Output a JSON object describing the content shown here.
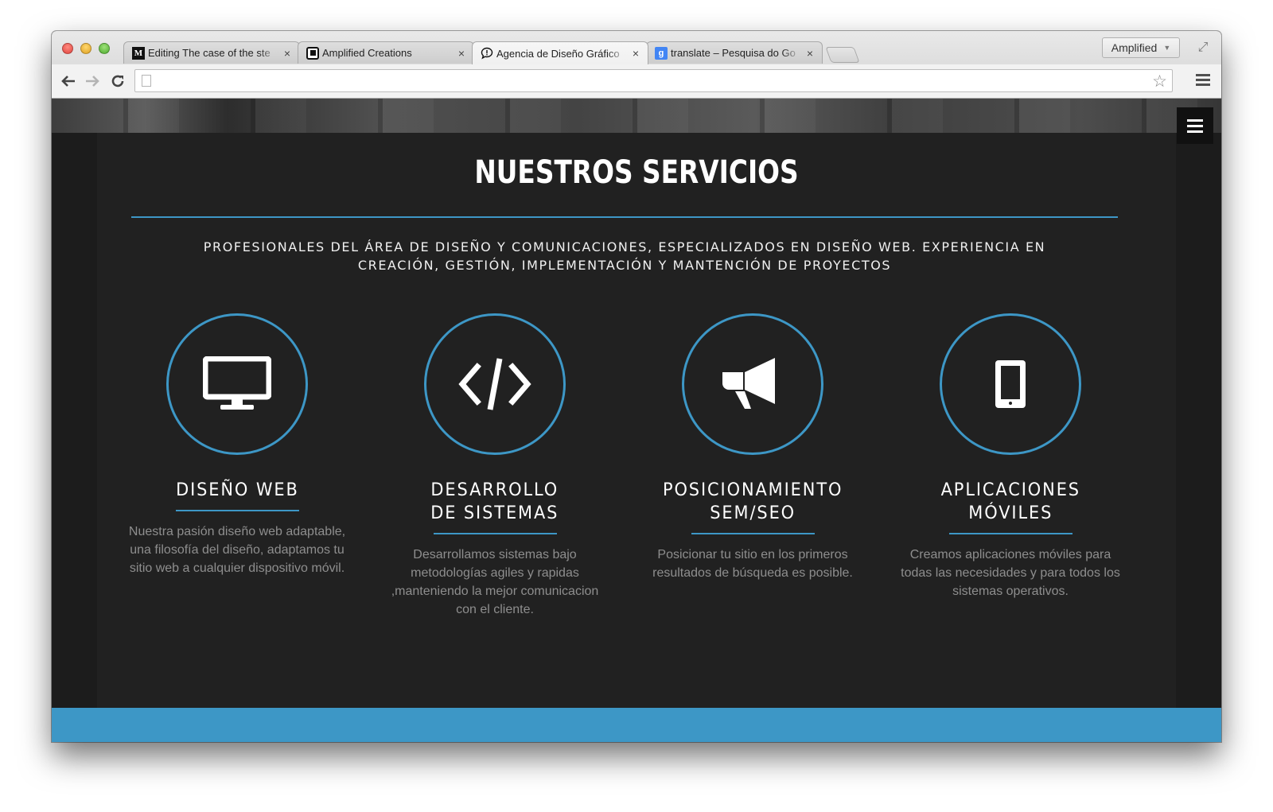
{
  "browser": {
    "tabs": [
      {
        "title": "Editing The case of the ste",
        "favicon": "medium-m-icon",
        "active": false
      },
      {
        "title": "Amplified Creations",
        "favicon": "amplified-icon",
        "active": false
      },
      {
        "title": "Agencia de Diseño Gráfico",
        "favicon": "speech-bubble-icon",
        "active": true
      },
      {
        "title": "translate – Pesquisa do Go",
        "favicon": "google-icon",
        "active": false
      }
    ],
    "profile_label": "Amplified",
    "url": ""
  },
  "page": {
    "title": "NUESTROS SERVICIOS",
    "subtitle": "PROFESIONALES DEL ÁREA DE DISEÑO Y COMUNICACIONES, ESPECIALIZADOS EN DISEÑO WEB. EXPERIENCIA EN CREACIÓN, GESTIÓN, IMPLEMENTACIÓN Y MANTENCIÓN DE PROYECTOS",
    "accent_color": "#3d97c6",
    "background_color": "#212121",
    "services": [
      {
        "icon": "desktop-monitor-icon",
        "title": "DISEÑO WEB",
        "description": "Nuestra pasión diseño web adaptable, una filosofía del diseño, adaptamos tu sitio web a cualquier dispositivo móvil."
      },
      {
        "icon": "code-icon",
        "title": "DESARROLLO\nDE SISTEMAS",
        "description": "Desarrollamos sistemas bajo metodologías agiles y rapidas ,manteniendo la mejor comunicacion con el cliente."
      },
      {
        "icon": "megaphone-icon",
        "title": "POSICIONAMIENTO\nSEM/SEO",
        "description": "Posicionar tu sitio en los primeros resultados de búsqueda es posible."
      },
      {
        "icon": "mobile-phone-icon",
        "title": "APLICACIONES\nMÓVILES",
        "description": "Creamos aplicaciones móviles para todas las necesidades y para todos los sistemas operativos."
      }
    ]
  }
}
